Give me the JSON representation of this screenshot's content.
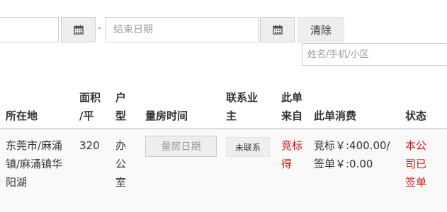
{
  "filters": {
    "start_date_value": "",
    "dash": "-",
    "end_date_placeholder": "结束日期",
    "calendar_icon": "calendar-icon",
    "clear_label": "清除",
    "search_placeholder": "姓名/手机/小区"
  },
  "table": {
    "headers": {
      "location": "所在地",
      "area_line1": "面积",
      "area_line2": "/平",
      "type_line1": "户",
      "type_line2": "型",
      "measure_time": "量房时间",
      "contact_line1": "联系业",
      "contact_line2": "主",
      "source_line1": "此单",
      "source_line2": "来自",
      "cost": "此单消费",
      "status": "状态"
    },
    "rows": [
      {
        "location_line1": "东莞市/麻涌",
        "location_line2": "镇/麻涌镇华",
        "location_line3": "阳湖",
        "area": "320",
        "type_line1": "办",
        "type_line2": "公",
        "type_line3": "室",
        "measure_button": "量房日期",
        "contact_badge": "未联系",
        "source_line1": "竞标",
        "source_line2": "得",
        "cost_line1": "竞标￥:400.00/",
        "cost_line2": "签单￥:0.00",
        "status_line1": "本公",
        "status_line2": "司已",
        "status_line3": "签单"
      }
    ]
  },
  "colors": {
    "accent_red": "#cc1b1b",
    "button_gray": "#eeeeee",
    "border_gray": "#cccccc"
  }
}
